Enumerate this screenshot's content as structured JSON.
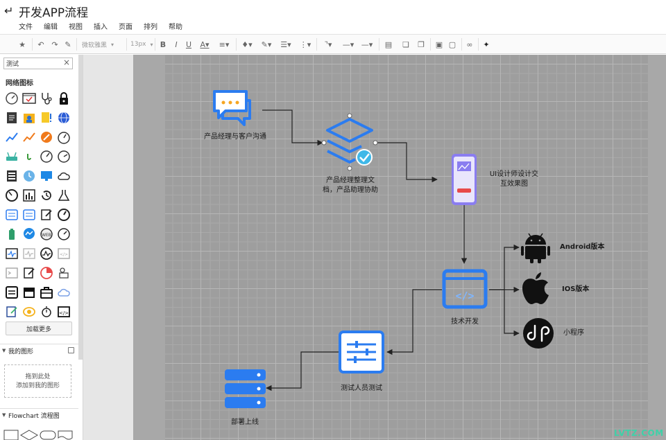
{
  "app": {
    "title": "开发APP流程",
    "menu": [
      "文件",
      "编辑",
      "视图",
      "插入",
      "页面",
      "排列",
      "帮助"
    ]
  },
  "toolbar": {
    "font_family": "微软雅黑",
    "font_size": "13px"
  },
  "sidebar": {
    "search_value": "测试",
    "network_section": "网络图标",
    "load_more": "加载更多",
    "my_shapes": "我的图形",
    "drop_zone_line1": "拖到此处",
    "drop_zone_line2": "添加到我的图形",
    "flowchart_section": "Flowchart 流程图"
  },
  "diagram": {
    "nodes": {
      "communicate": "产品经理与客户沟通",
      "docs_line1": "产品经理整理文",
      "docs_line2": "档，产品助理协助",
      "ui_line1": "UI设计师设计交",
      "ui_line2": "互效果图",
      "dev": "技术开发",
      "android": "Android版本",
      "ios": "IOS版本",
      "miniapp": "小程序",
      "test": "测试人员测试",
      "deploy": "部署上线"
    },
    "colors": {
      "accent": "#2b7cf0",
      "edge": "#222222",
      "ui_red": "#e84a4a",
      "ui_purple": "#8a7df0"
    }
  },
  "watermark": "LVTZ.COM"
}
